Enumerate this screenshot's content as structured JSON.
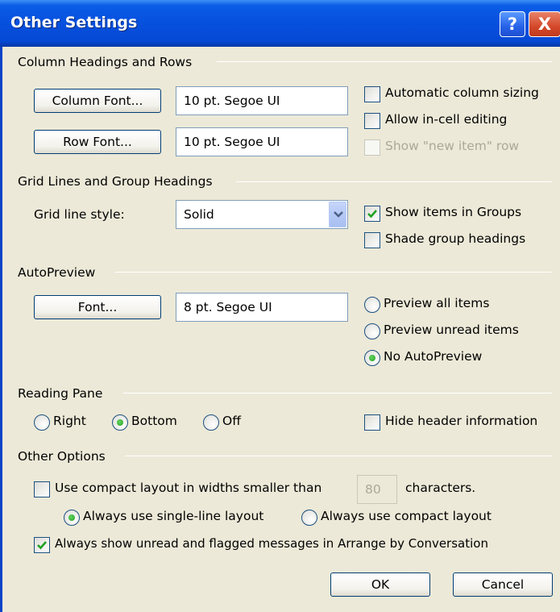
{
  "window": {
    "title": "Other Settings",
    "help_label": "?",
    "close_label": "X"
  },
  "column_headings": {
    "section_label": "Column Headings and Rows",
    "column_font_button": "Column Font...",
    "column_font_value": "10 pt. Segoe UI",
    "row_font_button": "Row Font...",
    "row_font_value": "10 pt. Segoe UI",
    "automatic_column_sizing": {
      "label": "Automatic column sizing",
      "checked": false
    },
    "allow_in_cell_editing": {
      "label": "Allow in-cell editing",
      "checked": false
    },
    "show_new_item_row": {
      "label": "Show \"new item\" row",
      "checked": false,
      "disabled": true
    }
  },
  "grid_lines": {
    "section_label": "Grid Lines and Group Headings",
    "grid_line_style_label": "Grid line style:",
    "grid_line_style_value": "Solid",
    "show_items_in_groups": {
      "label": "Show items in Groups",
      "checked": true
    },
    "shade_group_headings": {
      "label": "Shade group headings",
      "checked": false
    }
  },
  "autopreview": {
    "section_label": "AutoPreview",
    "font_button": "Font...",
    "font_value": "8 pt. Segoe UI",
    "options": [
      {
        "label": "Preview all items",
        "selected": false
      },
      {
        "label": "Preview unread items",
        "selected": false
      },
      {
        "label": "No AutoPreview",
        "selected": true
      }
    ]
  },
  "reading_pane": {
    "section_label": "Reading Pane",
    "options": [
      {
        "label": "Right",
        "selected": false
      },
      {
        "label": "Bottom",
        "selected": true
      },
      {
        "label": "Off",
        "selected": false
      }
    ],
    "hide_header_information": {
      "label": "Hide header information",
      "checked": false
    }
  },
  "other_options": {
    "section_label": "Other Options",
    "compact_layout": {
      "label": "Use compact layout in widths smaller than",
      "checked": false
    },
    "width_value": "80",
    "characters_label": "characters.",
    "layout_options": [
      {
        "label": "Always use single-line layout",
        "selected": true
      },
      {
        "label": "Always use compact layout",
        "selected": false
      }
    ],
    "always_show_unread": {
      "label": "Always show unread and flagged messages in Arrange by Conversation",
      "checked": true
    }
  },
  "footer": {
    "ok_label": "OK",
    "cancel_label": "Cancel"
  },
  "colors": {
    "titlebar": "#0650de",
    "dialog_background": "#ece9d8",
    "checkmark": "#21a121"
  }
}
